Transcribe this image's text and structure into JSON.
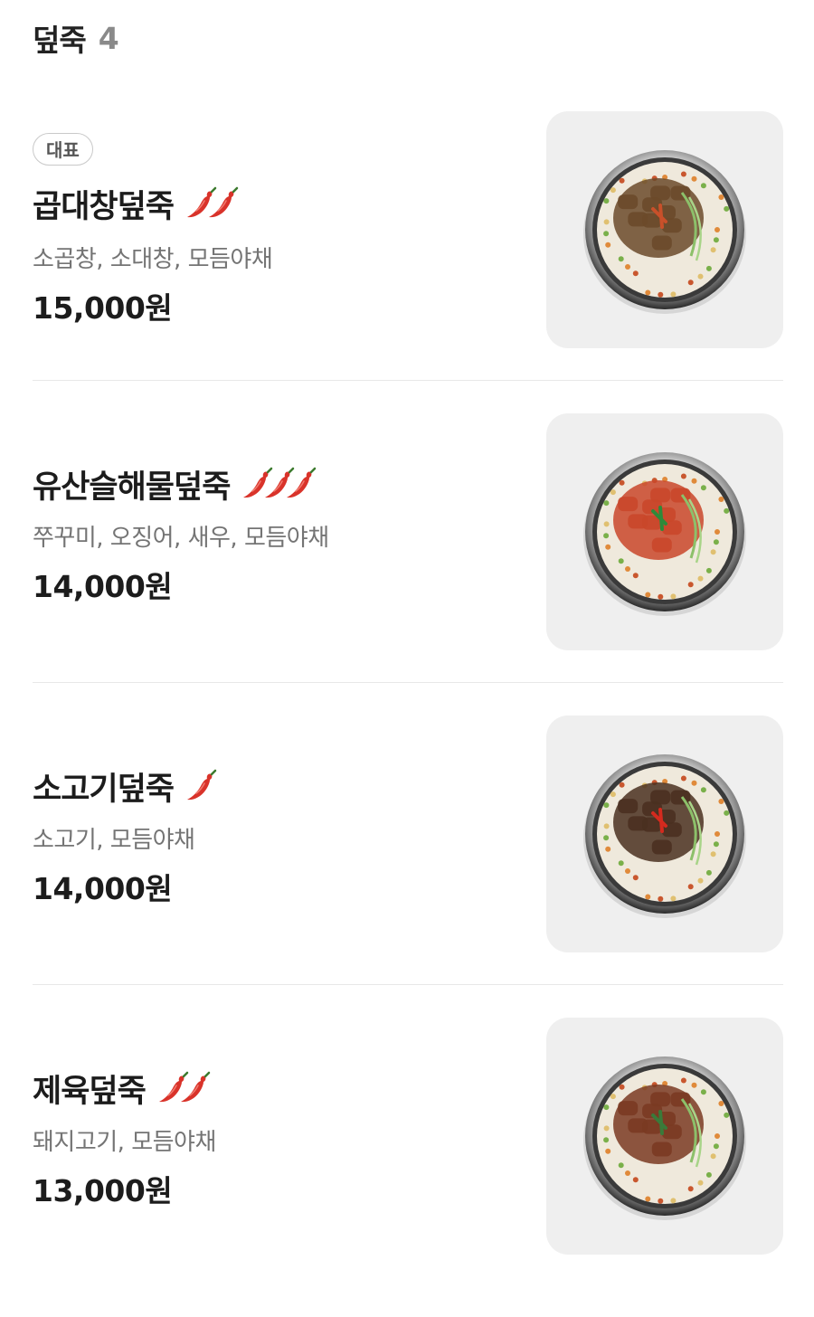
{
  "section": {
    "title": "덮죽",
    "count": "4"
  },
  "menu_items": [
    {
      "badge": "대표",
      "name": "곱대창덮죽",
      "spice_level": 2,
      "description": "소곱창, 소대창, 모듬야채",
      "price": "15,000원",
      "image_icon": "tripe-porridge-image",
      "topping_color": "#6b4a2a",
      "accent_color": "#c8502a"
    },
    {
      "badge": "",
      "name": "유산슬해물덮죽",
      "spice_level": 3,
      "description": "쭈꾸미, 오징어, 새우, 모듬야채",
      "price": "14,000원",
      "image_icon": "seafood-porridge-image",
      "topping_color": "#c9472a",
      "accent_color": "#2e8a3a"
    },
    {
      "badge": "",
      "name": "소고기덮죽",
      "spice_level": 1,
      "description": "소고기, 모듬야채",
      "price": "14,000원",
      "image_icon": "beef-porridge-image",
      "topping_color": "#4a3020",
      "accent_color": "#d42a1e"
    },
    {
      "badge": "",
      "name": "제육덮죽",
      "spice_level": 2,
      "description": "돼지고기, 모듬야채",
      "price": "13,000원",
      "image_icon": "pork-porridge-image",
      "topping_color": "#7a3a22",
      "accent_color": "#3a7a3a"
    }
  ],
  "colors": {
    "pepper": "#d9332a",
    "thumb_bg": "#efefef"
  }
}
